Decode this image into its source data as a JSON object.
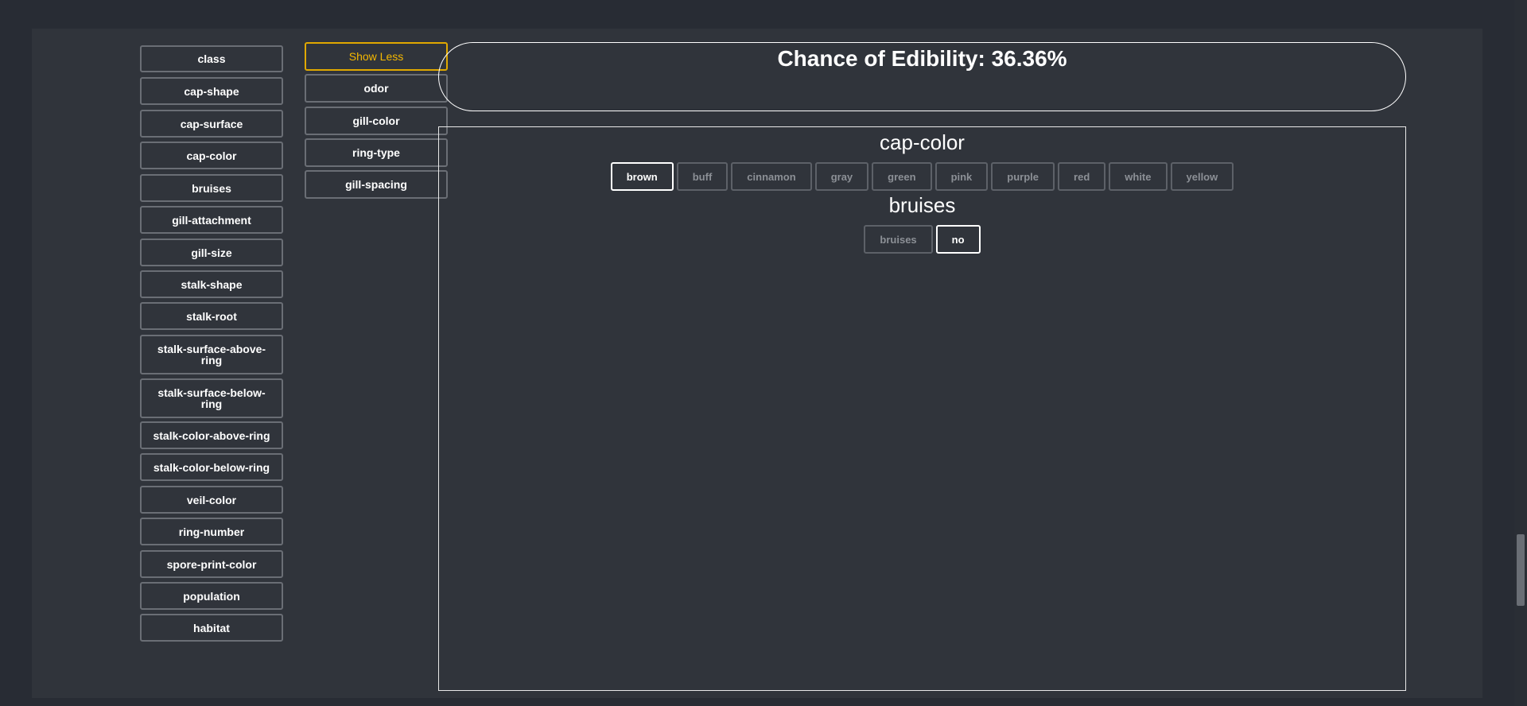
{
  "banner": {
    "title": "Chance of Edibility: 36.36%"
  },
  "left_features": [
    "class",
    "cap-shape",
    "cap-surface",
    "cap-color",
    "bruises",
    "gill-attachment",
    "gill-size",
    "stalk-shape",
    "stalk-root",
    "stalk-surface-above-ring",
    "stalk-surface-below-ring",
    "stalk-color-above-ring",
    "stalk-color-below-ring",
    "veil-color",
    "ring-number",
    "spore-print-color",
    "population",
    "habitat"
  ],
  "show_less_label": "Show Less",
  "selected_features": [
    "odor",
    "gill-color",
    "ring-type",
    "gill-spacing"
  ],
  "panel": {
    "features": [
      {
        "title": "cap-color",
        "options": [
          "brown",
          "buff",
          "cinnamon",
          "gray",
          "green",
          "pink",
          "purple",
          "red",
          "white",
          "yellow"
        ],
        "selected": "brown"
      },
      {
        "title": "bruises",
        "options": [
          "bruises",
          "no"
        ],
        "selected": "no"
      }
    ]
  },
  "colors": {
    "accent": "#f5b800",
    "background": "#30343b",
    "page_bg": "#282c34"
  }
}
